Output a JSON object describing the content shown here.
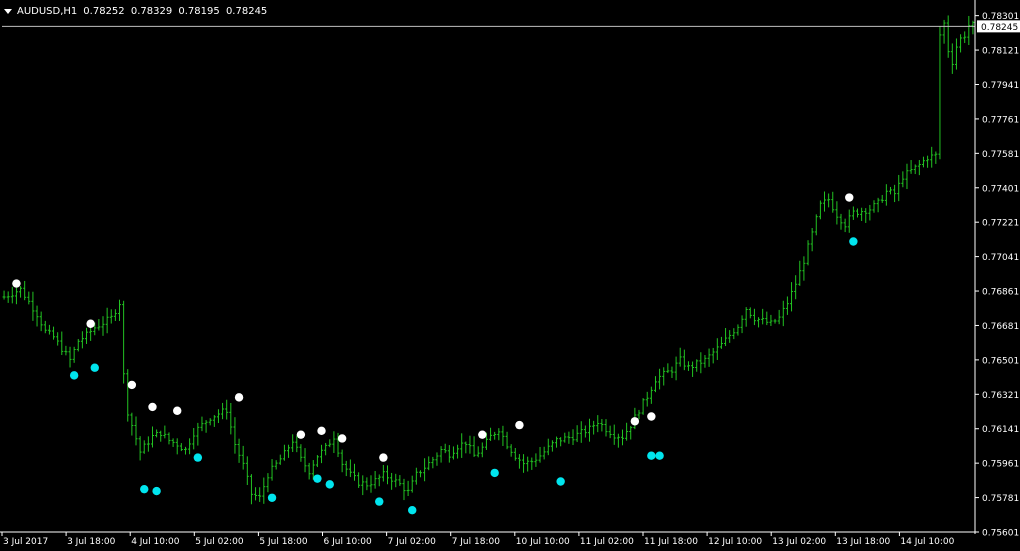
{
  "header": {
    "symbol": "AUDUSD,H1",
    "open": "0.78252",
    "high": "0.78329",
    "low": "0.78195",
    "close": "0.78245"
  },
  "colors": {
    "background": "#000000",
    "bars": "#22c322",
    "upper_dots": "#ffffff",
    "lower_dots": "#00e5ee",
    "axis": "#ffffff",
    "price_line": "#c0c0c0"
  },
  "chart_data": {
    "type": "ohlc",
    "grid": false,
    "legend": "none",
    "ylim": [
      0.75601,
      0.78341
    ],
    "current_price": "0.78245",
    "y_ticks": [
      "0.78301",
      "0.78121",
      "0.77941",
      "0.77761",
      "0.77581",
      "0.77401",
      "0.77221",
      "0.77041",
      "0.76861",
      "0.76681",
      "0.76501",
      "0.76321",
      "0.76141",
      "0.75961",
      "0.75781",
      "0.75601"
    ],
    "x_ticks": [
      "3 Jul 2017",
      "3 Jul 18:00",
      "4 Jul 10:00",
      "5 Jul 02:00",
      "5 Jul 18:00",
      "6 Jul 10:00",
      "7 Jul 02:00",
      "7 Jul 18:00",
      "10 Jul 10:00",
      "11 Jul 02:00",
      "11 Jul 18:00",
      "12 Jul 10:00",
      "13 Jul 02:00",
      "13 Jul 18:00",
      "14 Jul 10:00"
    ],
    "path_points": [
      [
        0,
        0.7683
      ],
      [
        4,
        0.7687
      ],
      [
        8,
        0.7674
      ],
      [
        10,
        0.7665
      ],
      [
        12,
        0.7662
      ],
      [
        16,
        0.765
      ],
      [
        18,
        0.766
      ],
      [
        20,
        0.7663
      ],
      [
        22,
        0.7667
      ],
      [
        26,
        0.7672
      ],
      [
        28,
        0.768
      ],
      [
        29,
        0.7642
      ],
      [
        30,
        0.7623
      ],
      [
        33,
        0.7602
      ],
      [
        36,
        0.761
      ],
      [
        38,
        0.7612
      ],
      [
        40,
        0.7608
      ],
      [
        42,
        0.7606
      ],
      [
        44,
        0.7603
      ],
      [
        46,
        0.7612
      ],
      [
        50,
        0.762
      ],
      [
        54,
        0.7624
      ],
      [
        56,
        0.7606
      ],
      [
        58,
        0.7595
      ],
      [
        60,
        0.758
      ],
      [
        62,
        0.7578
      ],
      [
        64,
        0.759
      ],
      [
        68,
        0.7601
      ],
      [
        70,
        0.7608
      ],
      [
        72,
        0.7598
      ],
      [
        74,
        0.7592
      ],
      [
        76,
        0.76
      ],
      [
        78,
        0.7604
      ],
      [
        80,
        0.761
      ],
      [
        82,
        0.7596
      ],
      [
        84,
        0.759
      ],
      [
        86,
        0.7586
      ],
      [
        88,
        0.7585
      ],
      [
        90,
        0.7587
      ],
      [
        92,
        0.759
      ],
      [
        94,
        0.7588
      ],
      [
        96,
        0.7585
      ],
      [
        98,
        0.7581
      ],
      [
        100,
        0.759
      ],
      [
        104,
        0.7598
      ],
      [
        106,
        0.7603
      ],
      [
        108,
        0.7601
      ],
      [
        110,
        0.7605
      ],
      [
        112,
        0.7607
      ],
      [
        114,
        0.76
      ],
      [
        116,
        0.7604
      ],
      [
        118,
        0.761
      ],
      [
        120,
        0.7614
      ],
      [
        122,
        0.7606
      ],
      [
        124,
        0.76
      ],
      [
        126,
        0.7596
      ],
      [
        128,
        0.7597
      ],
      [
        130,
        0.76
      ],
      [
        134,
        0.7608
      ],
      [
        138,
        0.761
      ],
      [
        142,
        0.7614
      ],
      [
        144,
        0.7618
      ],
      [
        146,
        0.7614
      ],
      [
        148,
        0.7611
      ],
      [
        150,
        0.761
      ],
      [
        152,
        0.7616
      ],
      [
        154,
        0.7624
      ],
      [
        156,
        0.7631
      ],
      [
        158,
        0.764
      ],
      [
        162,
        0.7645
      ],
      [
        164,
        0.765
      ],
      [
        166,
        0.7646
      ],
      [
        168,
        0.7648
      ],
      [
        170,
        0.765
      ],
      [
        174,
        0.7658
      ],
      [
        178,
        0.7668
      ],
      [
        180,
        0.7677
      ],
      [
        182,
        0.7672
      ],
      [
        186,
        0.7669
      ],
      [
        188,
        0.7672
      ],
      [
        190,
        0.768
      ],
      [
        192,
        0.769
      ],
      [
        194,
        0.7702
      ],
      [
        196,
        0.7716
      ],
      [
        198,
        0.7731
      ],
      [
        200,
        0.7734
      ],
      [
        202,
        0.7726
      ],
      [
        204,
        0.7721
      ],
      [
        206,
        0.7727
      ],
      [
        210,
        0.7729
      ],
      [
        212,
        0.7732
      ],
      [
        214,
        0.7738
      ],
      [
        216,
        0.7737
      ],
      [
        218,
        0.7746
      ],
      [
        222,
        0.7752
      ],
      [
        224,
        0.7756
      ],
      [
        226,
        0.7757
      ],
      [
        227,
        0.782
      ],
      [
        228,
        0.7826
      ],
      [
        229,
        0.7812
      ],
      [
        230,
        0.7806
      ],
      [
        231,
        0.7814
      ],
      [
        232,
        0.7818
      ],
      [
        233,
        0.782
      ],
      [
        234,
        0.7825
      ],
      [
        235,
        0.7825
      ]
    ],
    "fractal_up_dots": [
      {
        "bar": 3,
        "price": 0.769
      },
      {
        "bar": 21,
        "price": 0.7669
      },
      {
        "bar": 31,
        "price": 0.7637
      },
      {
        "bar": 36,
        "price": 0.76255
      },
      {
        "bar": 42,
        "price": 0.76235
      },
      {
        "bar": 57,
        "price": 0.76305
      },
      {
        "bar": 72,
        "price": 0.7611
      },
      {
        "bar": 77,
        "price": 0.7613
      },
      {
        "bar": 82,
        "price": 0.7609
      },
      {
        "bar": 92,
        "price": 0.7599
      },
      {
        "bar": 116,
        "price": 0.7611
      },
      {
        "bar": 125,
        "price": 0.7616
      },
      {
        "bar": 153,
        "price": 0.7618
      },
      {
        "bar": 157,
        "price": 0.76205
      },
      {
        "bar": 205,
        "price": 0.7735
      }
    ],
    "fractal_down_dots": [
      {
        "bar": 17,
        "price": 0.7642
      },
      {
        "bar": 22,
        "price": 0.7646
      },
      {
        "bar": 34,
        "price": 0.75825
      },
      {
        "bar": 37,
        "price": 0.75815
      },
      {
        "bar": 47,
        "price": 0.7599
      },
      {
        "bar": 65,
        "price": 0.7578
      },
      {
        "bar": 76,
        "price": 0.7588
      },
      {
        "bar": 79,
        "price": 0.7585
      },
      {
        "bar": 91,
        "price": 0.7576
      },
      {
        "bar": 99,
        "price": 0.75715
      },
      {
        "bar": 119,
        "price": 0.7591
      },
      {
        "bar": 135,
        "price": 0.75865
      },
      {
        "bar": 157,
        "price": 0.76
      },
      {
        "bar": 159,
        "price": 0.76
      },
      {
        "bar": 206,
        "price": 0.7712
      }
    ]
  }
}
